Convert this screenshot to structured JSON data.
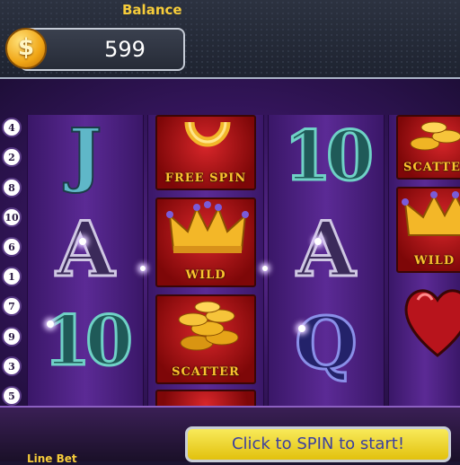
{
  "balance": {
    "label": "Balance",
    "value": "599",
    "coin_symbol": "$"
  },
  "paylines": [
    "4",
    "2",
    "8",
    "10",
    "6",
    "1",
    "7",
    "9",
    "3",
    "5"
  ],
  "reels": [
    [
      "J",
      "A",
      "10"
    ],
    [
      "FREE SPIN",
      "WILD",
      "SCATTER"
    ],
    [
      "10",
      "A",
      "Q"
    ],
    [
      "SCATTER",
      "WILD",
      "heart"
    ]
  ],
  "symbols": {
    "free_spin_label": "FREE SPIN",
    "wild_label": "WILD",
    "scatter_label": "SCATTER"
  },
  "bottom": {
    "line_bet_label": "Line Bet",
    "spin_label": "Click to SPIN to start!"
  },
  "colors": {
    "accent_gold": "#f6cc3a",
    "spin_button": "#f0d82a",
    "spin_text": "#3b3fa0",
    "reel_purple": "#5b2a95"
  }
}
